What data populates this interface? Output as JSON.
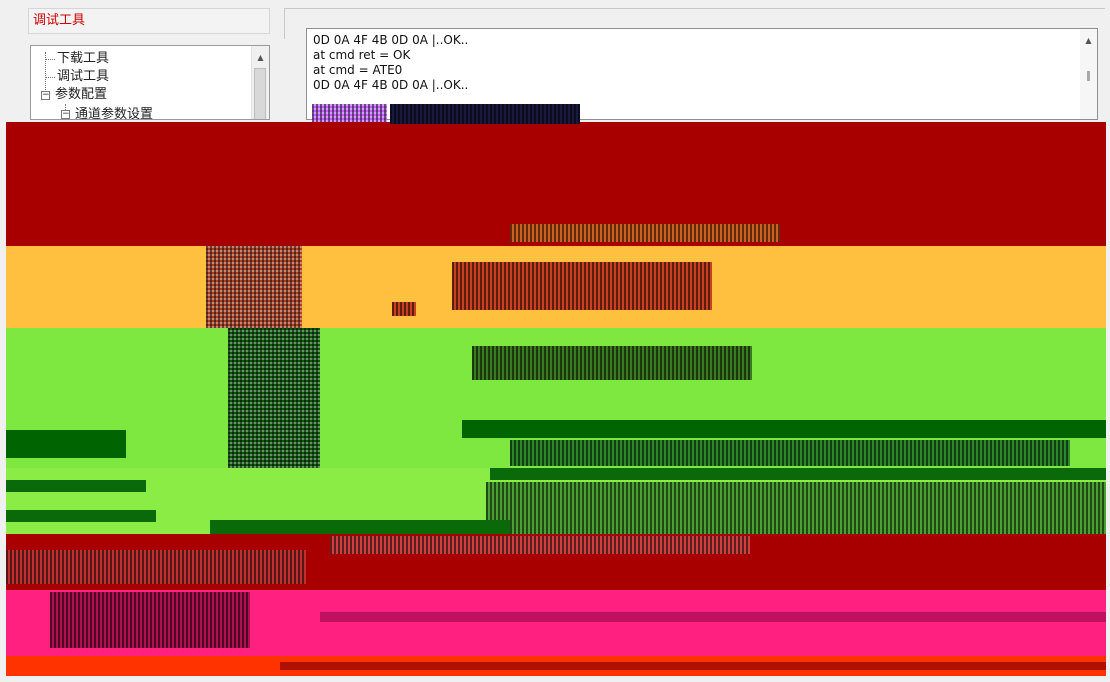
{
  "panel": {
    "title": "调试工具"
  },
  "tree": {
    "items": [
      {
        "label": "下载工具"
      },
      {
        "label": "调试工具"
      },
      {
        "label": "参数配置",
        "expander": "−"
      },
      {
        "label": "通道参数设置",
        "expander": "−"
      }
    ]
  },
  "log": {
    "lines": [
      "0D 0A 4F 4B 0D 0A  |..OK..",
      "at cmd ret = OK",
      "at cmd = ATE0",
      "0D 0A 4F 4B 0D 0A  |..OK.."
    ]
  },
  "colors": {
    "dark_red": "#a80000",
    "orange": "#ffc040",
    "green": "#7ee840",
    "dark_green": "#006400",
    "magenta": "#ff2080",
    "red_orange": "#ff3300"
  }
}
